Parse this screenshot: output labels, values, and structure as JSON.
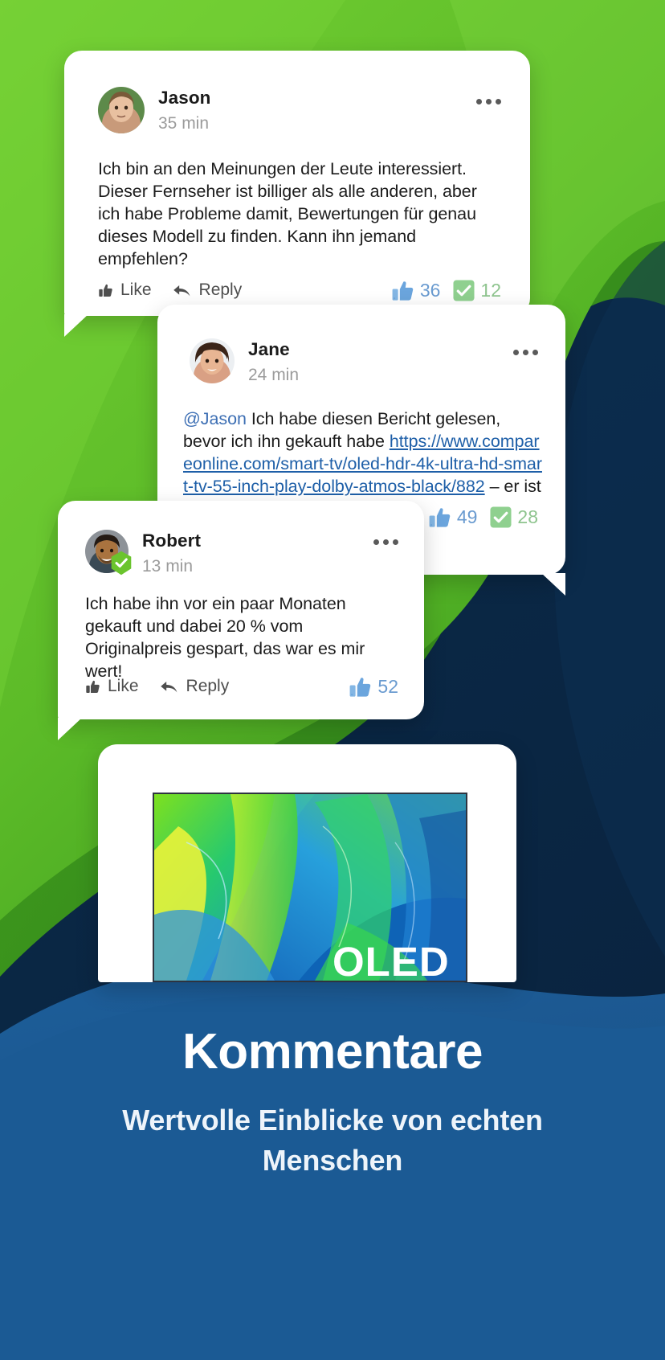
{
  "background": {
    "green_light": "#6ec92f",
    "green_mid": "#4eb021",
    "green_dark": "#2f8a1e",
    "blue_dark": "#0a2947",
    "blue_mid": "#124a7c",
    "blue_light": "#1f5f9b"
  },
  "comments": [
    {
      "id": "jason",
      "name": "Jason",
      "time": "35 min",
      "text": "Ich bin an den Meinungen der Leute interessiert. Dieser Fernseher ist billiger als alle anderen, aber ich habe Probleme damit, Bewertungen für genau dieses Modell zu finden. Kann ihn jemand empfehlen?",
      "verified": false,
      "menu_icon": "more-options-icon",
      "actions": {
        "like_label": "Like",
        "reply_label": "Reply"
      },
      "show_actions": true,
      "stats": {
        "likes": "36",
        "checks": "12",
        "show_checks": true
      }
    },
    {
      "id": "jane",
      "name": "Jane",
      "time": "24 min",
      "mention": "@Jason",
      "text_before_link": " Ich habe diesen Bericht gelesen, bevor ich ihn gekauft habe ",
      "link": "https://www.compareonline.com/smart-tv/oled-hdr-4k-ultra-hd-smart-tv-55-inch-play-dolby-atmos-black/882",
      "text_after_link": " – er ist sehr hilfreich.",
      "verified": false,
      "menu_icon": "more-options-icon",
      "show_actions": false,
      "stats": {
        "likes": "49",
        "checks": "28",
        "show_checks": true
      }
    },
    {
      "id": "robert",
      "name": "Robert",
      "time": "13 min",
      "text": "Ich habe ihn vor ein paar Monaten gekauft und dabei 20 % vom Originalpreis gespart, das war es mir wert!",
      "verified": true,
      "verified_icon": "verified-shield-icon",
      "menu_icon": "more-options-icon",
      "actions": {
        "like_label": "Like",
        "reply_label": "Reply"
      },
      "show_actions": true,
      "stats": {
        "likes": "52",
        "checks": "",
        "show_checks": false
      }
    }
  ],
  "product_card": {
    "name": "tv-product-card",
    "screen_label": "OLED"
  },
  "footer": {
    "heading": "Kommentare",
    "subheading": "Wertvolle Einblicke von echten Menschen"
  },
  "icons": {
    "thumb_up": "thumbs-up-icon",
    "reply_arrow": "reply-arrow-icon",
    "check_box": "green-check-icon",
    "more": "more-options-icon"
  }
}
